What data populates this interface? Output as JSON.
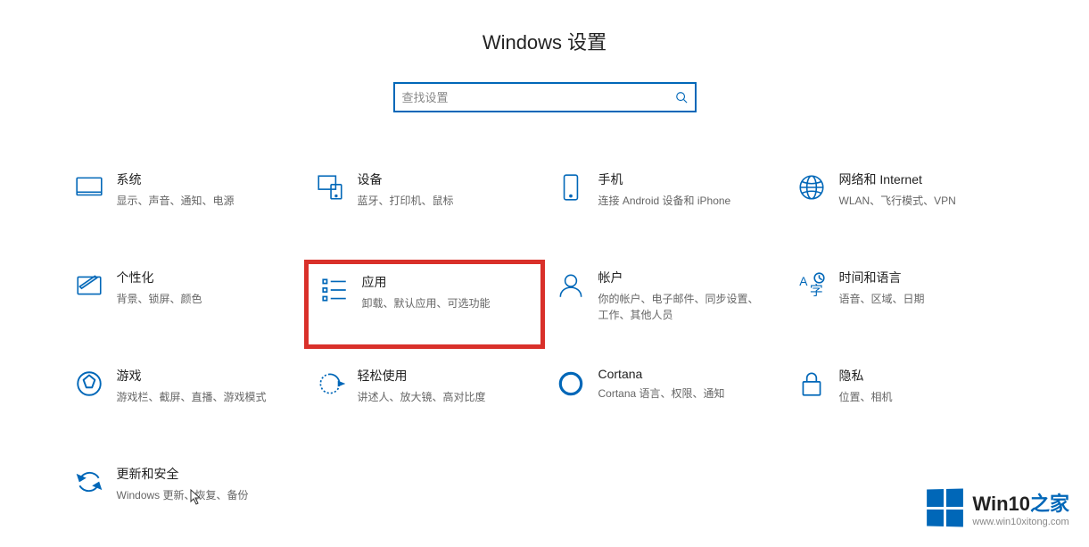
{
  "title": "Windows 设置",
  "search": {
    "placeholder": "查找设置"
  },
  "tiles": [
    {
      "id": "system",
      "title": "系统",
      "desc": "显示、声音、通知、电源"
    },
    {
      "id": "devices",
      "title": "设备",
      "desc": "蓝牙、打印机、鼠标"
    },
    {
      "id": "phone",
      "title": "手机",
      "desc": "连接 Android 设备和 iPhone"
    },
    {
      "id": "network",
      "title": "网络和 Internet",
      "desc": "WLAN、飞行模式、VPN"
    },
    {
      "id": "personalization",
      "title": "个性化",
      "desc": "背景、锁屏、颜色"
    },
    {
      "id": "apps",
      "title": "应用",
      "desc": "卸载、默认应用、可选功能"
    },
    {
      "id": "accounts",
      "title": "帐户",
      "desc": "你的帐户、电子邮件、同步设置、工作、其他人员"
    },
    {
      "id": "time-language",
      "title": "时间和语言",
      "desc": "语音、区域、日期"
    },
    {
      "id": "gaming",
      "title": "游戏",
      "desc": "游戏栏、截屏、直播、游戏模式"
    },
    {
      "id": "ease-of-access",
      "title": "轻松使用",
      "desc": "讲述人、放大镜、高对比度"
    },
    {
      "id": "cortana",
      "title": "Cortana",
      "desc": "Cortana 语言、权限、通知"
    },
    {
      "id": "privacy",
      "title": "隐私",
      "desc": "位置、相机"
    },
    {
      "id": "update-security",
      "title": "更新和安全",
      "desc": "Windows 更新、恢复、备份"
    }
  ],
  "highlighted": "apps",
  "watermark": {
    "brand1": "Win10",
    "brand2": "之家",
    "url": "www.win10xitong.com"
  }
}
